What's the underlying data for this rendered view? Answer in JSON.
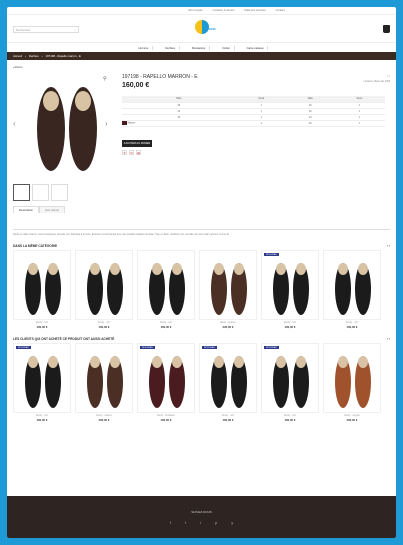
{
  "topbar": {
    "links": [
      "Mon compte",
      "Livraison & retours",
      "Paiement sécurisé",
      "Contact"
    ]
  },
  "search": {
    "placeholder": "Rechercher"
  },
  "logo": {
    "text": "BASS"
  },
  "menu": {
    "items": [
      "Homme",
      "Derbies",
      "Mocassins",
      "Outlet",
      "Carte cadeau"
    ]
  },
  "breadcrumb": {
    "items": [
      "Accueil",
      "Derbies",
      "197198 - Rapello marron - E"
    ]
  },
  "back_label": "Retour",
  "product": {
    "title": "197198 - RAPELLO MARRON - E",
    "price": "160,00 €",
    "share": "f t",
    "shipping": "Livraison offerte dès 100€",
    "size_headers": [
      "Taille",
      "Stock",
      "Taille",
      "Stock"
    ],
    "rows": [
      [
        "39",
        "1",
        "40",
        "1"
      ],
      [
        "41",
        "1",
        "42",
        "1"
      ],
      [
        "43",
        "1",
        "44",
        "1"
      ],
      [
        "45",
        "1",
        "46",
        "1"
      ]
    ],
    "color_label": "Marron",
    "add_to_cart": "AJOUTER AU PANIER"
  },
  "tabs": [
    "Description",
    "Avis clients"
  ],
  "description": "Derby en daim marron, cousu Goodyear, semelle cuir. Fabriqué à la main. Entretien recommandé avec des produits adaptés au daim. Tige en daim, doublure cuir, semelle cuir avec patin gomme. Forme E.",
  "section1": {
    "title": "DANS LA MÊME CATÉGORIE",
    "items": [
      {
        "name": "Derby - noir",
        "price": "160,00 €",
        "badge": ""
      },
      {
        "name": "Derby - noir",
        "price": "160,00 €",
        "badge": ""
      },
      {
        "name": "Derby - noir",
        "price": "160,00 €",
        "badge": ""
      },
      {
        "name": "Boots - marron",
        "price": "220,00 €",
        "badge": ""
      },
      {
        "name": "Derby - noir",
        "price": "160,00 €",
        "badge": "NOUVEAU"
      },
      {
        "name": "Derby - noir",
        "price": "160,00 €",
        "badge": ""
      }
    ]
  },
  "section2": {
    "title": "LES CLIENTS QUI ONT ACHETÉ CE PRODUIT ONT AUSSI ACHETÉ",
    "items": [
      {
        "name": "Derby - noir",
        "price": "160,00 €",
        "badge": "NOUVEAU"
      },
      {
        "name": "Derby - marron",
        "price": "160,00 €",
        "badge": ""
      },
      {
        "name": "Derby - bordeaux",
        "price": "160,00 €",
        "badge": "NOUVEAU"
      },
      {
        "name": "Derby - noir",
        "price": "160,00 €",
        "badge": "NOUVEAU"
      },
      {
        "name": "Derby - noir",
        "price": "160,00 €",
        "badge": "NOUVEAU"
      },
      {
        "name": "Derby - cognac",
        "price": "160,00 €",
        "badge": ""
      }
    ]
  },
  "footer": {
    "title": "SUIVEZ-NOUS",
    "icons": [
      "f",
      "t",
      "i",
      "p",
      "y"
    ]
  }
}
